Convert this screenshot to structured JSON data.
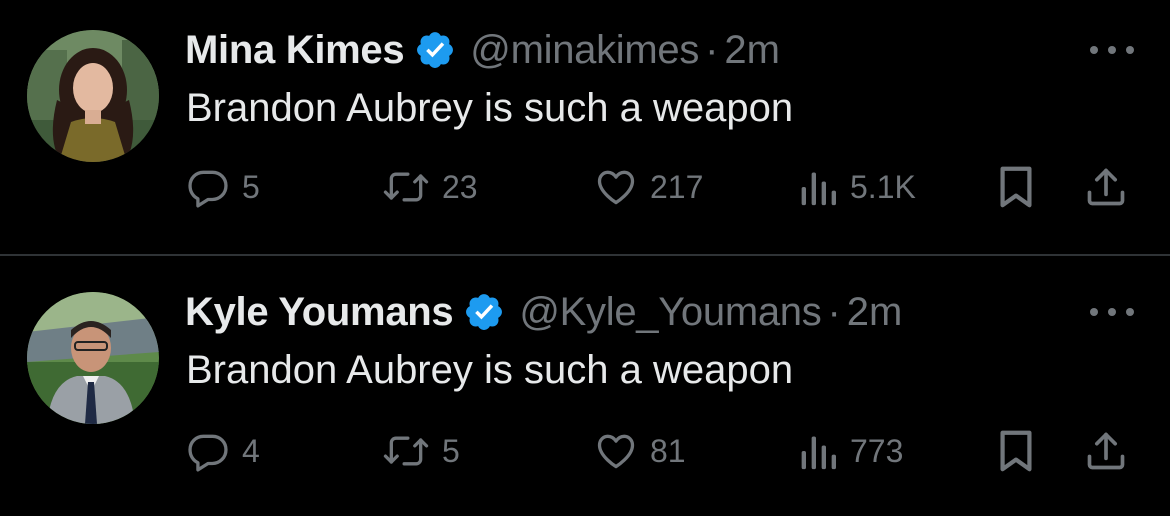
{
  "tweets": [
    {
      "name": "Mina Kimes",
      "handle": "@minakimes",
      "separator": "·",
      "time": "2m",
      "text": "Brandon Aubrey is such a weapon",
      "replies": "5",
      "retweets": "23",
      "likes": "217",
      "views": "5.1K"
    },
    {
      "name": "Kyle Youmans",
      "handle": "@Kyle_Youmans",
      "separator": "·",
      "time": "2m",
      "text": "Brandon Aubrey is such a weapon",
      "replies": "4",
      "retweets": "5",
      "likes": "81",
      "views": "773"
    }
  ],
  "colors": {
    "background": "#000000",
    "primary_text": "#e7e9ea",
    "secondary_text": "#71767b",
    "verified_blue": "#1d9bf0",
    "divider": "#2f3336"
  },
  "icons": [
    "verified-badge-icon",
    "more-icon",
    "reply-icon",
    "retweet-icon",
    "like-icon",
    "views-icon",
    "bookmark-icon",
    "share-icon"
  ]
}
